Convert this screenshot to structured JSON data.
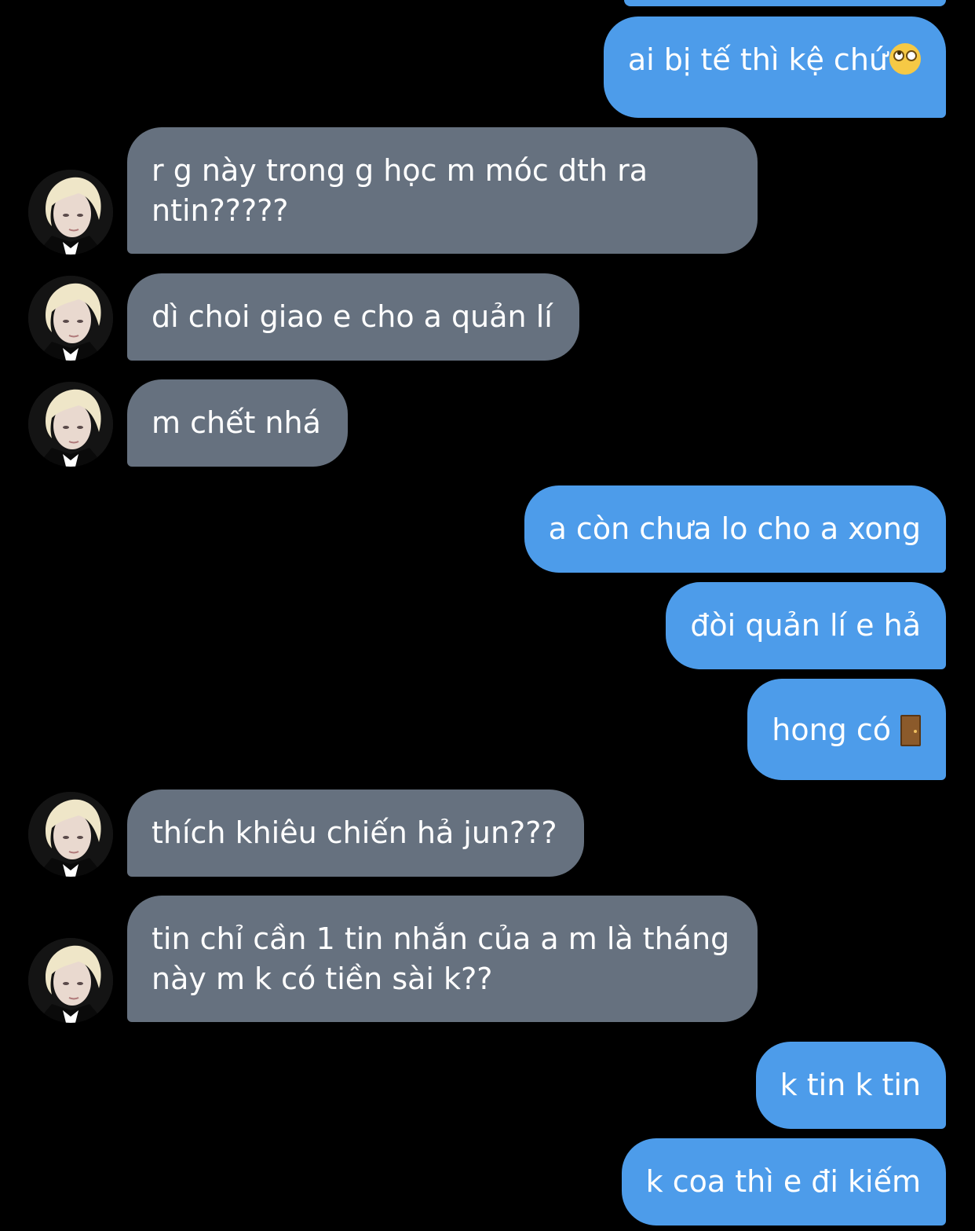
{
  "conversation": {
    "messages": [
      {
        "side": "sent",
        "text": "ai bị tế thì kệ chứ",
        "emoji": "eye-roll-emoji"
      },
      {
        "side": "received",
        "lines": [
          "r g này trong g học m móc dth ra",
          "ntin?????"
        ]
      },
      {
        "side": "received",
        "text": "dì choi giao e cho a quản lí"
      },
      {
        "side": "received",
        "text": "m chết nhá"
      },
      {
        "side": "sent",
        "text": "a còn chưa lo cho a xong"
      },
      {
        "side": "sent",
        "text": "đòi quản lí e hả"
      },
      {
        "side": "sent",
        "text": "hong có",
        "emoji": "door-emoji"
      },
      {
        "side": "received",
        "text": "thích khiêu chiến hả jun???"
      },
      {
        "side": "received",
        "lines": [
          "tin chỉ cần 1 tin nhắn của a m là tháng",
          "này m k có tiền sài k??"
        ]
      },
      {
        "side": "sent",
        "text": "k tin k tin"
      },
      {
        "side": "sent",
        "text": "k coa thì e đi kiếm"
      }
    ]
  },
  "colors": {
    "background": "#000000",
    "sent_bubble": "#4d9cea",
    "received_bubble": "#66717f",
    "text": "#ffffff"
  }
}
